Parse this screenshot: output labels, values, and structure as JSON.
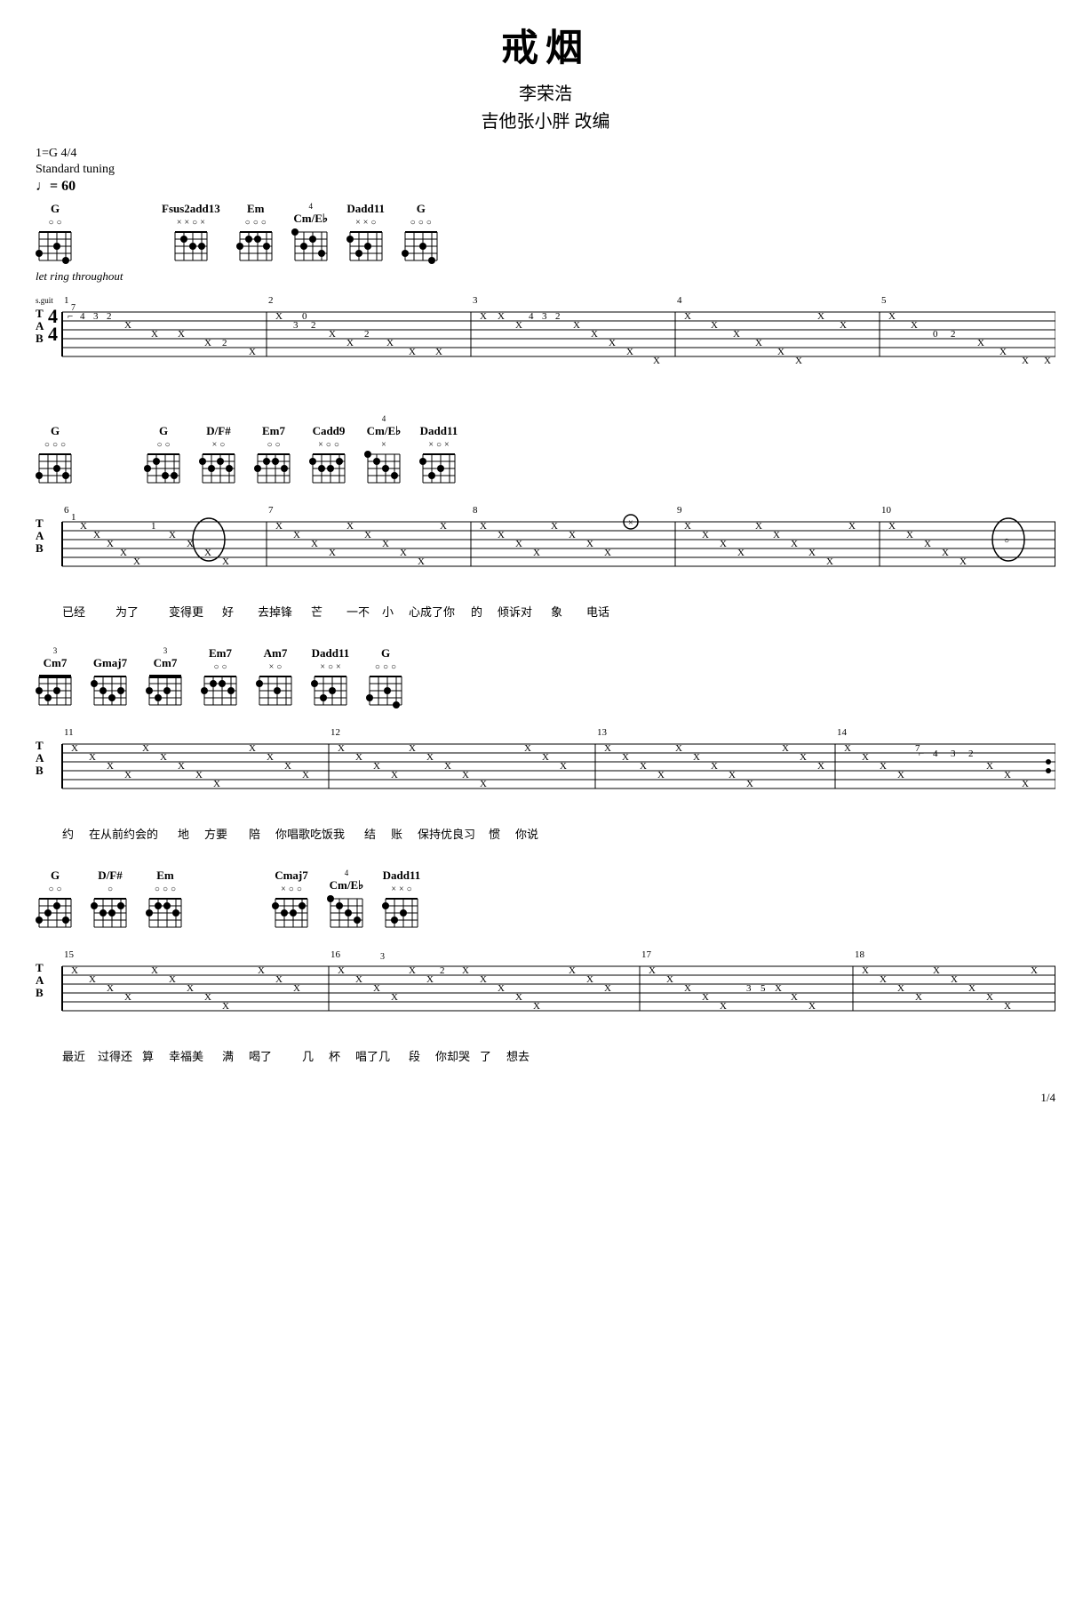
{
  "title": "戒烟",
  "artist": "李荣浩",
  "arranger": "吉他张小胖 改编",
  "key": "1=G  4/4",
  "tuning": "Standard tuning",
  "tempo": "♩= 60",
  "let_ring": "let ring throughout",
  "page": "1/4",
  "sections": [
    {
      "chords": [
        "G",
        "Fsus2add13",
        "Em",
        "Cm/E♭",
        "Dadd11",
        "G"
      ],
      "bar_numbers": [
        1,
        2,
        3,
        4,
        5
      ]
    },
    {
      "chords": [
        "G",
        "G",
        "D/F#",
        "Em7",
        "Cadd9",
        "Cm/E♭",
        "Dadd11"
      ],
      "bar_numbers": [
        6,
        7,
        8,
        9,
        10
      ],
      "lyrics": [
        "已经",
        "为了",
        "变得更",
        "好",
        "去掉锋",
        "芒",
        "一不",
        "小",
        "心成了你",
        "的",
        "倾诉对",
        "象",
        "电话"
      ]
    },
    {
      "chords": [
        "Cm7",
        "Gmaj7",
        "Cm7",
        "Em7",
        "Am7",
        "Dadd11",
        "G"
      ],
      "bar_numbers": [
        11,
        12,
        13,
        14
      ],
      "lyrics": [
        "约",
        "在从前约会的",
        "地",
        "方要",
        "陪",
        "你唱歌吃饭我",
        "结",
        "账",
        "保持优良习",
        "惯",
        "你说"
      ]
    },
    {
      "chords": [
        "G",
        "D/F#",
        "Em",
        "Cmaj7",
        "Cm/E♭",
        "Dadd11"
      ],
      "bar_numbers": [
        15,
        16,
        17,
        18
      ],
      "lyrics": [
        "最近",
        "过得还",
        "算",
        "幸福美",
        "满",
        "喝了",
        "几",
        "杯",
        "唱了几",
        "段",
        "你却哭",
        "了",
        "想去"
      ]
    }
  ]
}
